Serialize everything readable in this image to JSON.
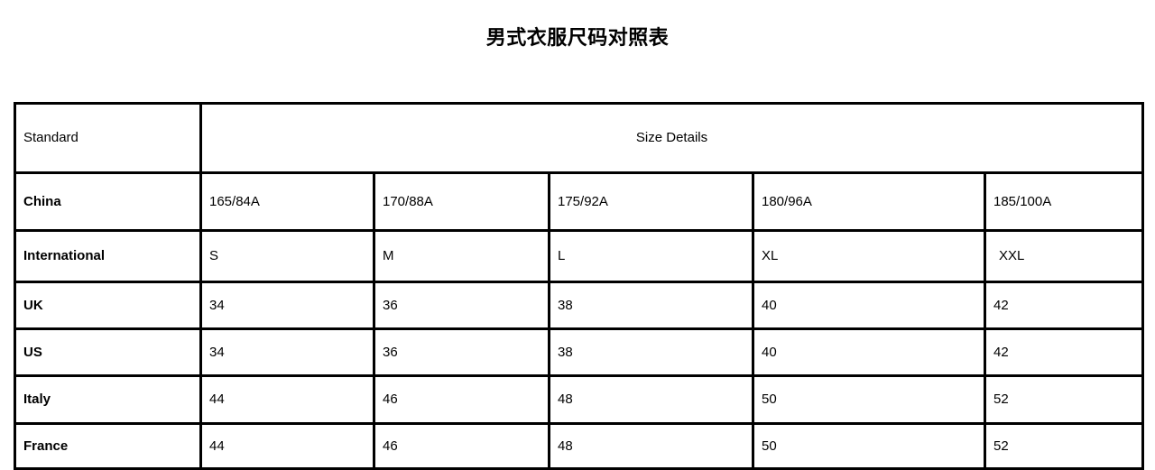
{
  "title": "男式衣服尺码对照表",
  "table": {
    "header": {
      "standard_label": "Standard",
      "details_label": "Size Details"
    },
    "rows": [
      {
        "label": "China",
        "values": [
          "165/84A",
          "170/88A",
          "175/92A",
          "180/96A",
          "185/100A"
        ]
      },
      {
        "label": "International",
        "values": [
          "S",
          "M",
          "L",
          "XL",
          "XXL"
        ]
      },
      {
        "label": "UK",
        "values": [
          "34",
          "36",
          "38",
          "40",
          "42"
        ]
      },
      {
        "label": "US",
        "values": [
          "34",
          "36",
          "38",
          "40",
          "42"
        ]
      },
      {
        "label": "Italy",
        "values": [
          "44",
          "46",
          "48",
          "50",
          "52"
        ]
      },
      {
        "label": "France",
        "values": [
          "44",
          "46",
          "48",
          "50",
          "52"
        ]
      }
    ]
  },
  "colors": {
    "text": "#000000",
    "border": "#000000",
    "background": "#ffffff"
  }
}
